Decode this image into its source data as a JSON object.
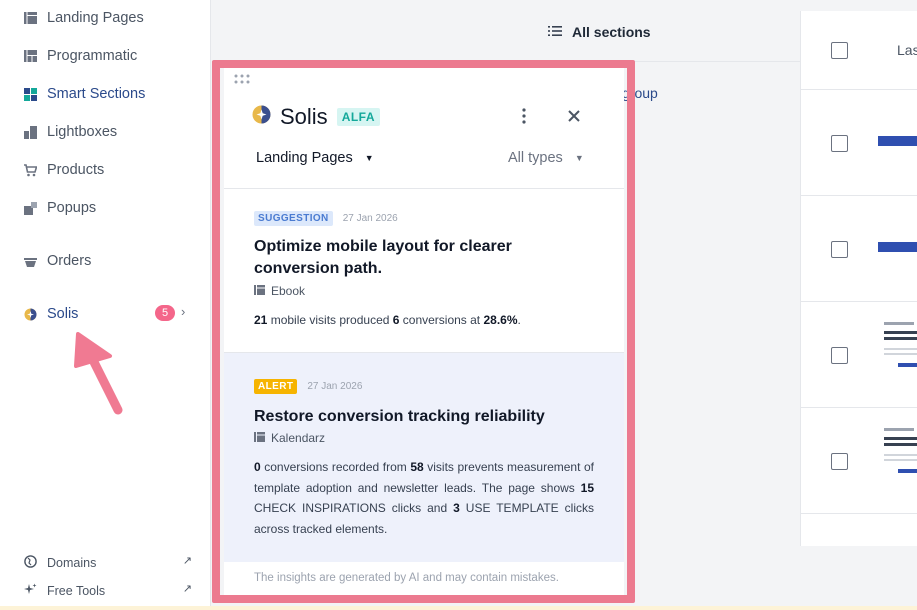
{
  "sidebar": {
    "items": [
      {
        "label": "Landing Pages",
        "icon": "landing-pages-icon"
      },
      {
        "label": "Programmatic",
        "icon": "programmatic-icon"
      },
      {
        "label": "Smart Sections",
        "icon": "smart-sections-icon",
        "active": true
      },
      {
        "label": "Lightboxes",
        "icon": "lightboxes-icon"
      },
      {
        "label": "Products",
        "icon": "cart-icon"
      },
      {
        "label": "Popups",
        "icon": "popups-icon"
      },
      {
        "label": "Orders",
        "icon": "orders-icon"
      },
      {
        "label": "Solis",
        "icon": "solis-icon",
        "badge": "5"
      }
    ],
    "footer": [
      {
        "label": "Domains",
        "icon": "globe-icon"
      },
      {
        "label": "Free Tools",
        "icon": "sparkle-icon"
      }
    ]
  },
  "topbar": {
    "all_sections": "All sections",
    "group_link": "group"
  },
  "table": {
    "header_label": "Las"
  },
  "panel": {
    "title": "Solis",
    "badge": "ALFA",
    "filter_page": "Landing Pages",
    "filter_type": "All types",
    "disclaimer": "The insights are generated by AI and may contain mistakes.",
    "cards": [
      {
        "tag": "SUGGESTION",
        "date": "27 Jan 2026",
        "title": "Optimize mobile layout for clearer conversion path.",
        "page": "Ebook",
        "body_parts": [
          "21",
          " mobile visits produced ",
          "6",
          " conversions at ",
          "28.6%",
          "."
        ]
      },
      {
        "tag": "ALERT",
        "date": "27 Jan 2026",
        "title": "Restore conversion tracking reliability",
        "page": "Kalendarz",
        "body_parts": [
          "0",
          " conversions recorded from ",
          "58",
          " visits prevents measurement of template adoption and newsletter leads. The page shows ",
          "15",
          " CHECK INSPIRATIONS clicks and ",
          "3",
          " USE TEMPLATE clicks across tracked elements."
        ]
      }
    ]
  },
  "colors": {
    "accent": "#2b4a8b",
    "highlight_frame": "#ec7a8f",
    "badge": "#f4668a",
    "alert": "#f6b400",
    "suggestion": "#dce8fb"
  }
}
